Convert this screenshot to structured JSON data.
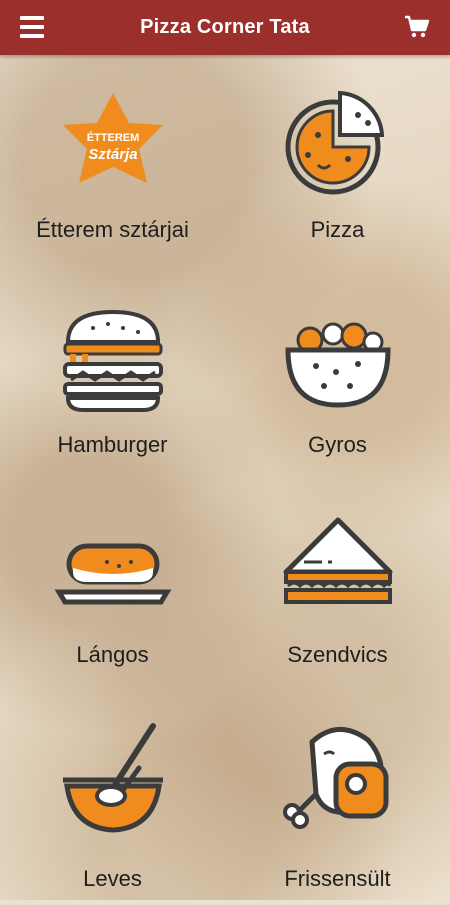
{
  "header": {
    "title": "Pizza Corner Tata",
    "menu_icon": "hamburger-menu-icon",
    "cart_icon": "shopping-cart-icon",
    "background_color": "#9b2f2c"
  },
  "categories": [
    {
      "label": "Étterem sztárjai",
      "icon": "star-badge-icon",
      "badge_line1": "ÉTTEREM",
      "badge_line2": "Sztárja"
    },
    {
      "label": "Pizza",
      "icon": "pizza-icon"
    },
    {
      "label": "Hamburger",
      "icon": "hamburger-icon"
    },
    {
      "label": "Gyros",
      "icon": "gyros-icon"
    },
    {
      "label": "Lángos",
      "icon": "langos-icon"
    },
    {
      "label": "Szendvics",
      "icon": "sandwich-icon"
    },
    {
      "label": "Leves",
      "icon": "soup-icon"
    },
    {
      "label": "Frissensült",
      "icon": "steak-icon"
    }
  ],
  "colors": {
    "accent_orange": "#f08c1e",
    "icon_outline": "#3b3b3b"
  }
}
